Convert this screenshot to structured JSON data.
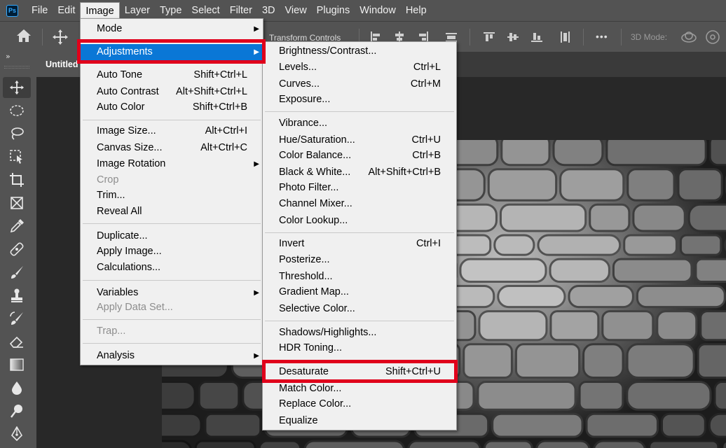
{
  "app": {
    "logo_text": "Ps"
  },
  "menubar": [
    "File",
    "Edit",
    "Image",
    "Layer",
    "Type",
    "Select",
    "Filter",
    "3D",
    "View",
    "Plugins",
    "Window",
    "Help"
  ],
  "active_menu": "Image",
  "options_bar": {
    "transform_controls_label": "Transform Controls",
    "mode_3d_label": "3D Mode:",
    "more_label": "•••"
  },
  "document": {
    "tab_title": "Untitled"
  },
  "image_menu": [
    {
      "label": "Mode",
      "shortcut": "",
      "submenu": true
    },
    {
      "label": "Adjustments",
      "shortcut": "",
      "submenu": true,
      "highlighted": true
    },
    {
      "label": "Auto Tone",
      "shortcut": "Shift+Ctrl+L"
    },
    {
      "label": "Auto Contrast",
      "shortcut": "Alt+Shift+Ctrl+L"
    },
    {
      "label": "Auto Color",
      "shortcut": "Shift+Ctrl+B"
    },
    {
      "label": "Image Size...",
      "shortcut": "Alt+Ctrl+I"
    },
    {
      "label": "Canvas Size...",
      "shortcut": "Alt+Ctrl+C"
    },
    {
      "label": "Image Rotation",
      "shortcut": "",
      "submenu": true
    },
    {
      "label": "Crop",
      "shortcut": "",
      "disabled": true
    },
    {
      "label": "Trim...",
      "shortcut": ""
    },
    {
      "label": "Reveal All",
      "shortcut": ""
    },
    {
      "label": "Duplicate...",
      "shortcut": ""
    },
    {
      "label": "Apply Image...",
      "shortcut": ""
    },
    {
      "label": "Calculations...",
      "shortcut": ""
    },
    {
      "label": "Variables",
      "shortcut": "",
      "submenu": true
    },
    {
      "label": "Apply Data Set...",
      "shortcut": "",
      "disabled": true
    },
    {
      "label": "Trap...",
      "shortcut": "",
      "disabled": true
    },
    {
      "label": "Analysis",
      "shortcut": "",
      "submenu": true
    }
  ],
  "adjustments_menu": [
    {
      "label": "Brightness/Contrast...",
      "shortcut": ""
    },
    {
      "label": "Levels...",
      "shortcut": "Ctrl+L"
    },
    {
      "label": "Curves...",
      "shortcut": "Ctrl+M"
    },
    {
      "label": "Exposure...",
      "shortcut": ""
    },
    {
      "label": "Vibrance...",
      "shortcut": ""
    },
    {
      "label": "Hue/Saturation...",
      "shortcut": "Ctrl+U"
    },
    {
      "label": "Color Balance...",
      "shortcut": "Ctrl+B"
    },
    {
      "label": "Black & White...",
      "shortcut": "Alt+Shift+Ctrl+B"
    },
    {
      "label": "Photo Filter...",
      "shortcut": ""
    },
    {
      "label": "Channel Mixer...",
      "shortcut": ""
    },
    {
      "label": "Color Lookup...",
      "shortcut": ""
    },
    {
      "label": "Invert",
      "shortcut": "Ctrl+I"
    },
    {
      "label": "Posterize...",
      "shortcut": ""
    },
    {
      "label": "Threshold...",
      "shortcut": ""
    },
    {
      "label": "Gradient Map...",
      "shortcut": ""
    },
    {
      "label": "Selective Color...",
      "shortcut": ""
    },
    {
      "label": "Shadows/Highlights...",
      "shortcut": ""
    },
    {
      "label": "HDR Toning...",
      "shortcut": ""
    },
    {
      "label": "Desaturate",
      "shortcut": "Shift+Ctrl+U",
      "annotated": true
    },
    {
      "label": "Match Color...",
      "shortcut": ""
    },
    {
      "label": "Replace Color...",
      "shortcut": ""
    },
    {
      "label": "Equalize",
      "shortcut": ""
    }
  ],
  "colors": {
    "highlight": "#0a77d6",
    "annotation": "#e0001b",
    "menu_bg": "#f0f0f0",
    "chrome": "#535353"
  },
  "toolbar": {
    "collapse_label": "»"
  }
}
